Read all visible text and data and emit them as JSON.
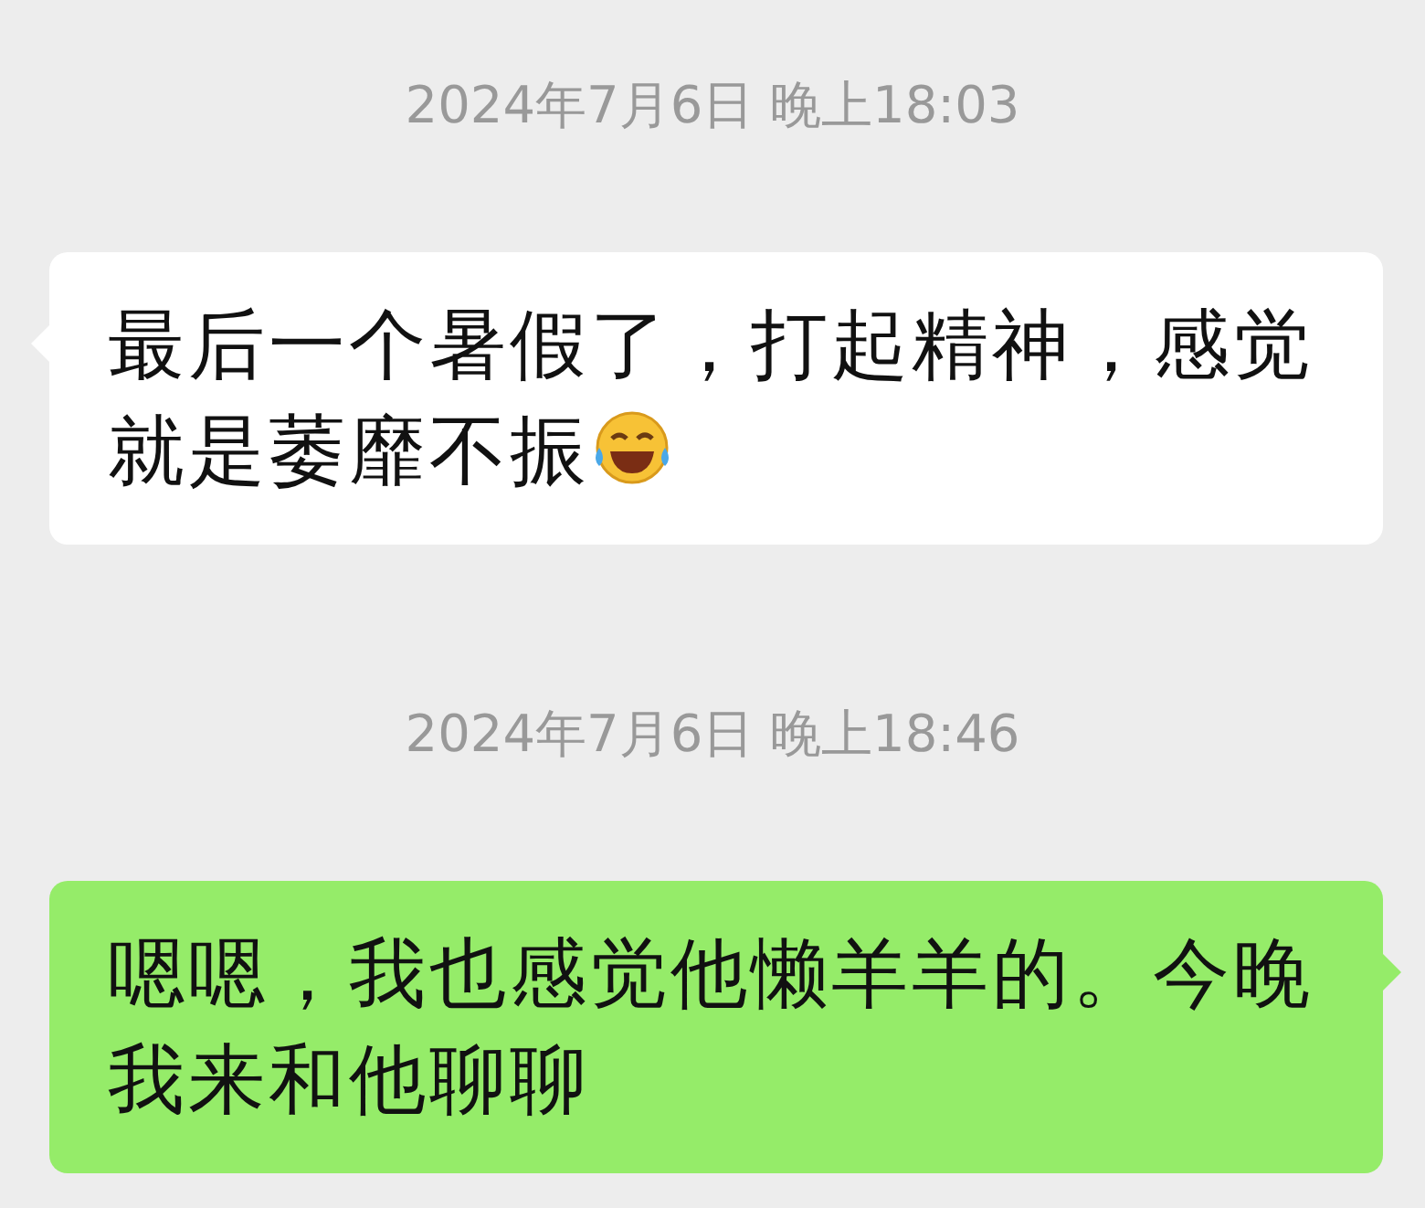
{
  "items": [
    {
      "kind": "time",
      "text": "2024年7月6日 晚上18:03"
    },
    {
      "kind": "incoming",
      "text": "最后一个暑假了，打起精神，感觉就是萎靡不振",
      "emoji": true
    },
    {
      "kind": "time",
      "text": "2024年7月6日 晚上18:46"
    },
    {
      "kind": "outgoing",
      "text": "嗯嗯，我也感觉他懒羊羊的。今晚我来和他聊聊",
      "emoji": false
    }
  ]
}
